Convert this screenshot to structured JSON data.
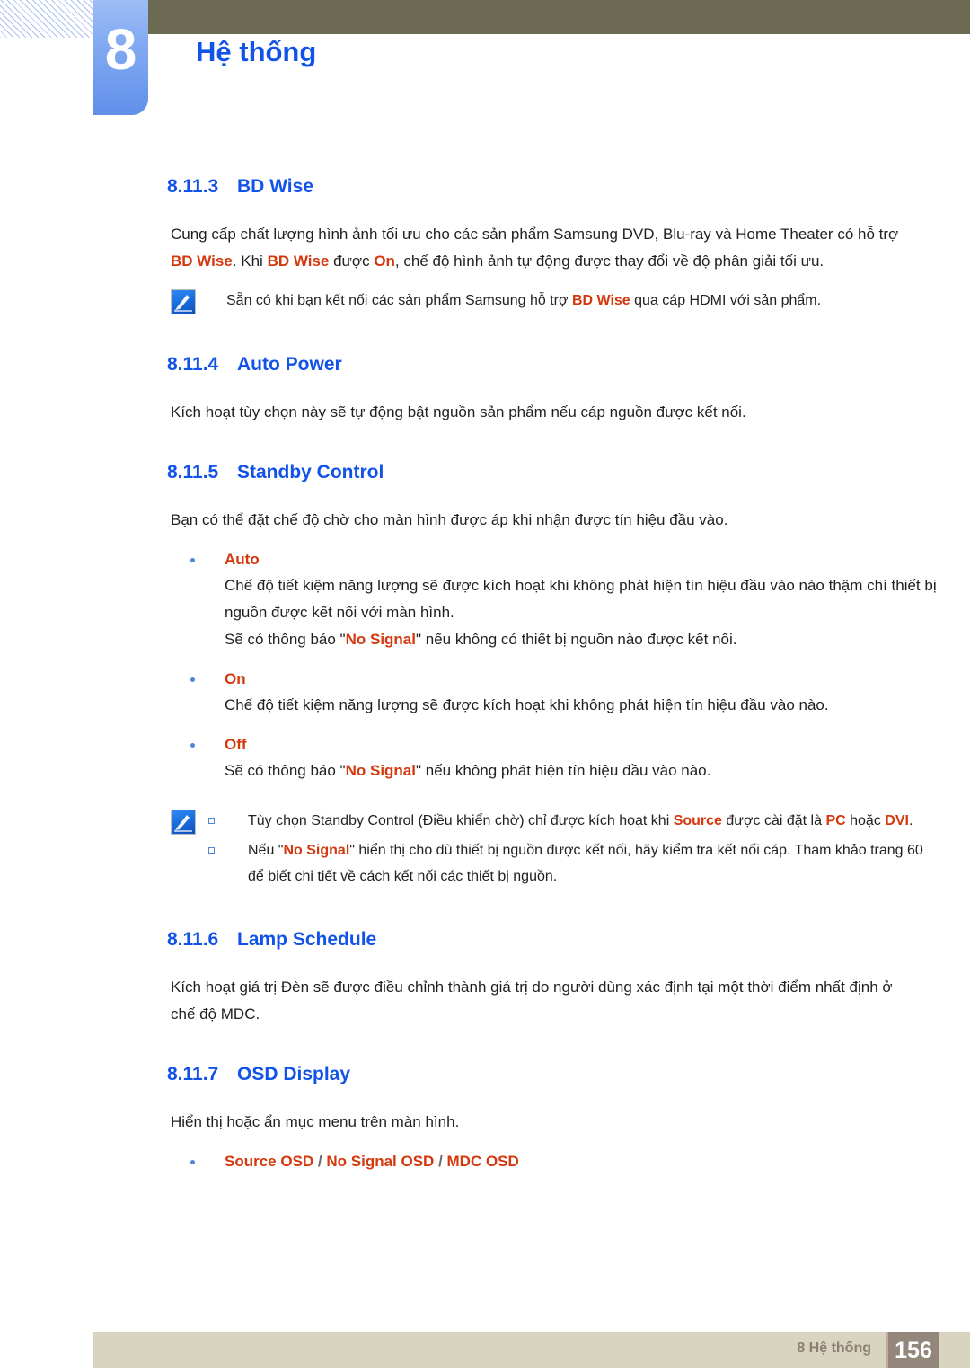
{
  "header": {
    "chapter_number": "8",
    "chapter_title": "Hệ thống",
    "accent_blue": "#1152e8",
    "olive": "#6d6a54"
  },
  "sections": [
    {
      "number": "8.11.3",
      "title": "BD Wise",
      "paragraph_parts": [
        {
          "text": "Cung cấp chất lượng hình ảnh tối ưu cho các sản phẩm Samsung DVD, Blu-ray và Home Theater có hỗ trợ ",
          "style": "plain"
        },
        {
          "text": "BD Wise",
          "style": "keyword"
        },
        {
          "text": ". Khi ",
          "style": "plain"
        },
        {
          "text": "BD Wise",
          "style": "keyword"
        },
        {
          "text": " được ",
          "style": "plain"
        },
        {
          "text": "On",
          "style": "keyword"
        },
        {
          "text": ", chế độ hình ảnh tự động được thay đổi về độ phân giải tối ưu.",
          "style": "plain"
        }
      ],
      "note_parts": [
        {
          "text": "Sẵn có khi bạn kết nối các sản phẩm Samsung hỗ trợ ",
          "style": "plain"
        },
        {
          "text": "BD Wise",
          "style": "keyword"
        },
        {
          "text": " qua cáp HDMI với sản phẩm.",
          "style": "plain"
        }
      ]
    },
    {
      "number": "8.11.4",
      "title": "Auto Power",
      "paragraph": "Kích hoạt tùy chọn này sẽ tự động bật nguồn sản phẩm nếu cáp nguồn được kết nối."
    },
    {
      "number": "8.11.5",
      "title": "Standby Control",
      "paragraph": "Bạn có thể đặt chế độ chờ cho màn hình được áp khi nhận được tín hiệu đầu vào."
    },
    {
      "number": "8.11.6",
      "title": "Lamp Schedule",
      "paragraph": "Kích hoạt giá trị Đèn sẽ được điều chỉnh thành giá trị do người dùng xác định tại một thời điểm nhất định ở chế độ MDC."
    },
    {
      "number": "8.11.7",
      "title": "OSD Display",
      "paragraph": "Hiển thị hoặc ẩn mục menu trên màn hình."
    }
  ],
  "standby_options": [
    {
      "label": "Auto",
      "lines": [
        [
          {
            "text": "Chế độ tiết kiệm năng lượng sẽ được kích hoạt khi không phát hiện tín hiệu đầu vào nào thậm chí thiết bị nguồn được kết nối với màn hình.",
            "style": "plain"
          }
        ],
        [
          {
            "text": "Sẽ có thông báo \"",
            "style": "plain"
          },
          {
            "text": "No Signal",
            "style": "keyword"
          },
          {
            "text": "\" nếu không có thiết bị nguồn nào được kết nối.",
            "style": "plain"
          }
        ]
      ]
    },
    {
      "label": "On",
      "lines": [
        [
          {
            "text": "Chế độ tiết kiệm năng lượng sẽ được kích hoạt khi không phát hiện tín hiệu đầu vào nào.",
            "style": "plain"
          }
        ]
      ]
    },
    {
      "label": "Off",
      "lines": [
        [
          {
            "text": "Sẽ có thông báo \"",
            "style": "plain"
          },
          {
            "text": "No Signal",
            "style": "keyword"
          },
          {
            "text": "\" nếu không phát hiện tín hiệu đầu vào nào.",
            "style": "plain"
          }
        ]
      ]
    }
  ],
  "standby_note_items": [
    [
      {
        "text": "Tùy chọn Standby Control (Điều khiển chờ) chỉ được kích hoạt khi ",
        "style": "plain"
      },
      {
        "text": "Source",
        "style": "keyword"
      },
      {
        "text": " được cài đặt là ",
        "style": "plain"
      },
      {
        "text": "PC",
        "style": "keyword"
      },
      {
        "text": " hoặc ",
        "style": "plain"
      },
      {
        "text": "DVI",
        "style": "keyword"
      },
      {
        "text": ".",
        "style": "plain"
      }
    ],
    [
      {
        "text": "Nếu \"",
        "style": "plain"
      },
      {
        "text": "No Signal",
        "style": "keyword"
      },
      {
        "text": "\" hiển thị cho dù thiết bị nguồn được kết nối, hãy kiểm tra kết nối cáp. Tham khảo trang 60 để biết chi tiết về cách kết nối các thiết bị nguồn.",
        "style": "plain"
      }
    ]
  ],
  "osd_bullet": [
    {
      "text": "Source OSD",
      "style": "keyword"
    },
    {
      "text": " / ",
      "style": "sep"
    },
    {
      "text": "No Signal OSD",
      "style": "keyword"
    },
    {
      "text": " / ",
      "style": "sep"
    },
    {
      "text": "MDC OSD",
      "style": "keyword"
    }
  ],
  "footer": {
    "label": "8 Hệ thống",
    "page_number": "156",
    "bar_color": "#d9d4c0",
    "page_box_color": "#93867b"
  },
  "icons": {
    "note": "note-pen-icon"
  }
}
